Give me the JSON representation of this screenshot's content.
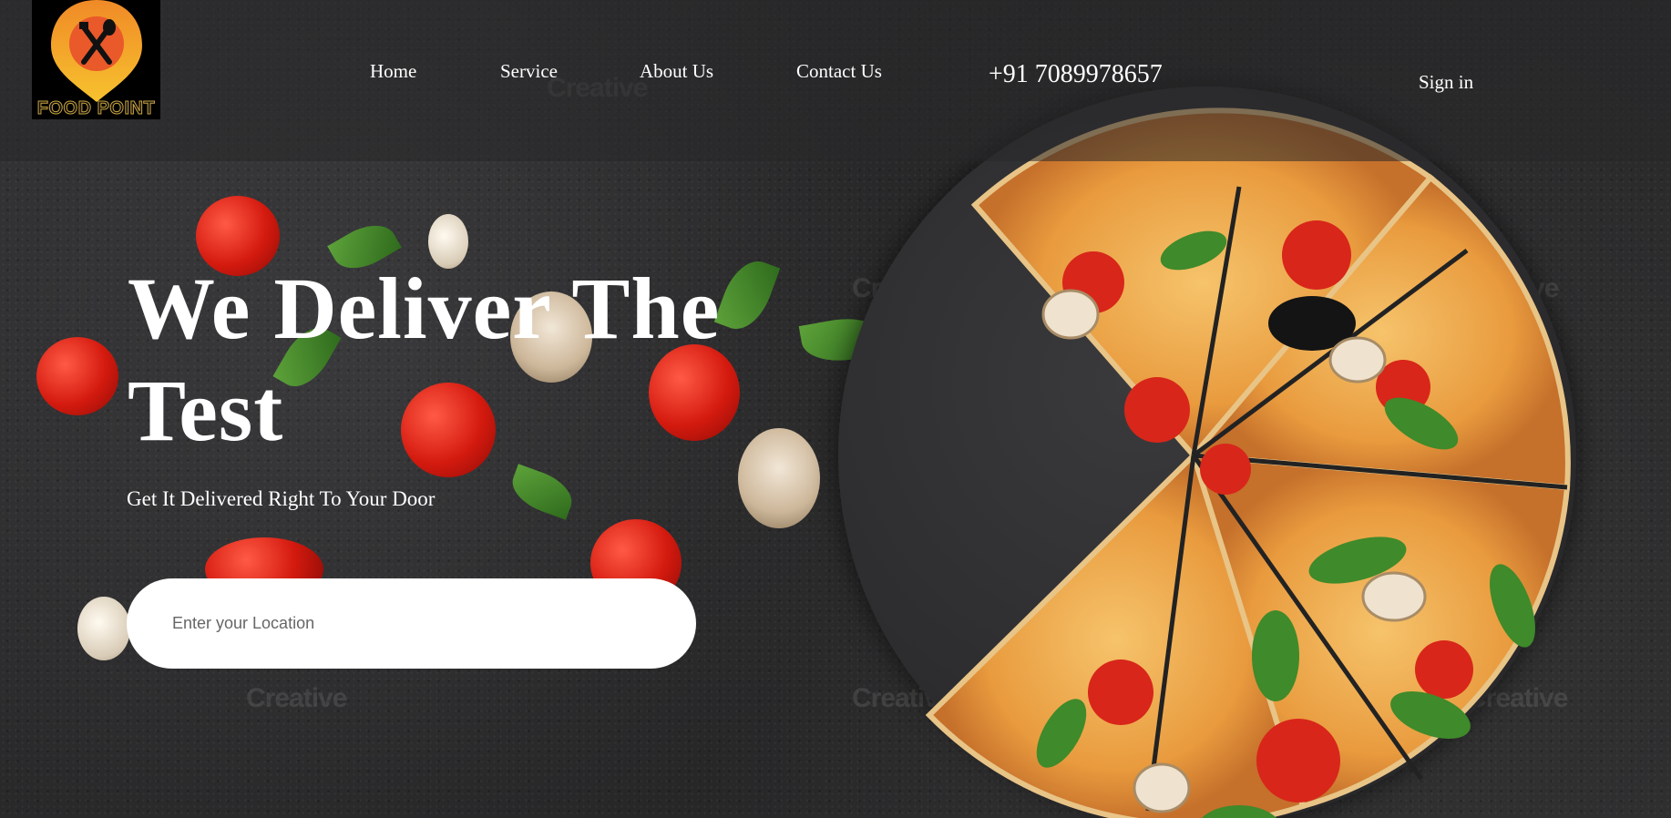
{
  "brand": {
    "logo_text": "FOOD POINT",
    "accent_colors": [
      "#f5a623",
      "#e9592a",
      "#caa33b"
    ]
  },
  "nav": {
    "items": [
      {
        "label": "Home"
      },
      {
        "label": "Service"
      },
      {
        "label": "About Us"
      },
      {
        "label": "Contact Us"
      }
    ],
    "phone": "+91 7089978657",
    "sign_in": "Sign in"
  },
  "hero": {
    "title": "We Deliver The Test",
    "subtitle": "Get It Delivered Right To Your Door",
    "location_placeholder": "Enter your Location"
  },
  "watermark": "Creative",
  "icons": {
    "logo": "map-pin-fork-spoon-icon"
  }
}
